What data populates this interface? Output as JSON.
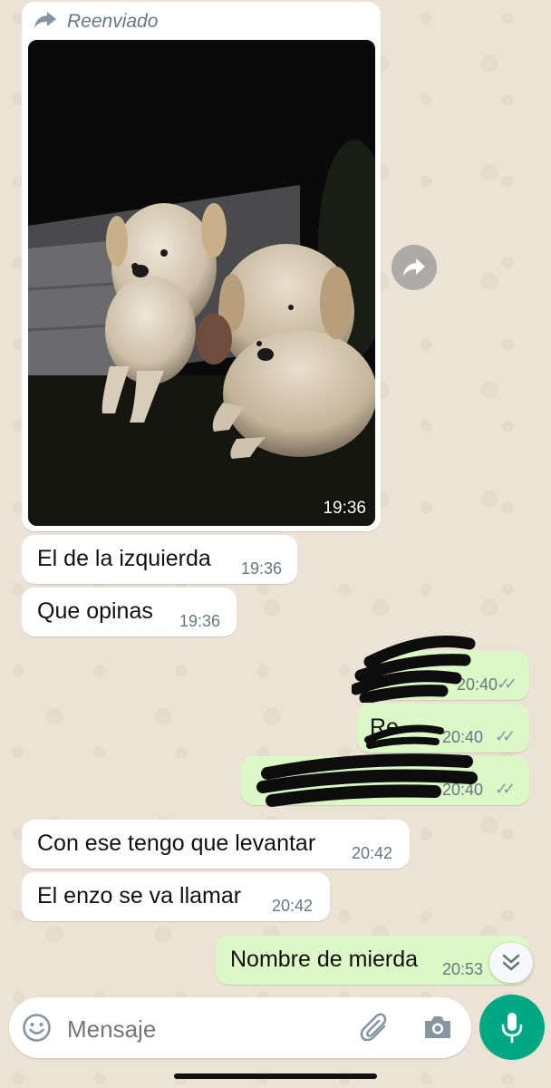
{
  "forwarded": {
    "label": "Reenviado",
    "photo_time": "19:36"
  },
  "messages": [
    {
      "dir": "in",
      "text": "El de la izquierda",
      "time": "19:36"
    },
    {
      "dir": "in",
      "text": "Que opinas",
      "time": "19:36"
    },
    {
      "dir": "out",
      "text": "",
      "time": "20:40",
      "ticks": "✓✓",
      "redacted": true
    },
    {
      "dir": "out",
      "text": "Re",
      "time": "20:40",
      "ticks": "✓✓",
      "redacted": true
    },
    {
      "dir": "out",
      "text": "",
      "time": "20:40",
      "ticks": "✓✓",
      "redacted": true
    },
    {
      "dir": "in",
      "text": "Con ese tengo que levantar",
      "time": "20:42"
    },
    {
      "dir": "in",
      "text": "El enzo se va llamar",
      "time": "20:42"
    },
    {
      "dir": "out",
      "text": "Nombre de mierda",
      "time": "20:53",
      "ticks": "✓✓"
    }
  ],
  "composer": {
    "placeholder": "Mensaje"
  },
  "icons": {
    "forward": "forward-arrow-icon",
    "emoji": "emoji-icon",
    "attach": "paperclip-icon",
    "camera": "camera-icon",
    "mic": "microphone-icon",
    "scroll": "chevron-double-down-icon"
  },
  "colors": {
    "incoming": "#ffffff",
    "outgoing": "#dcf8c6",
    "accent": "#00a884",
    "read_ticks": "#8696a0"
  }
}
